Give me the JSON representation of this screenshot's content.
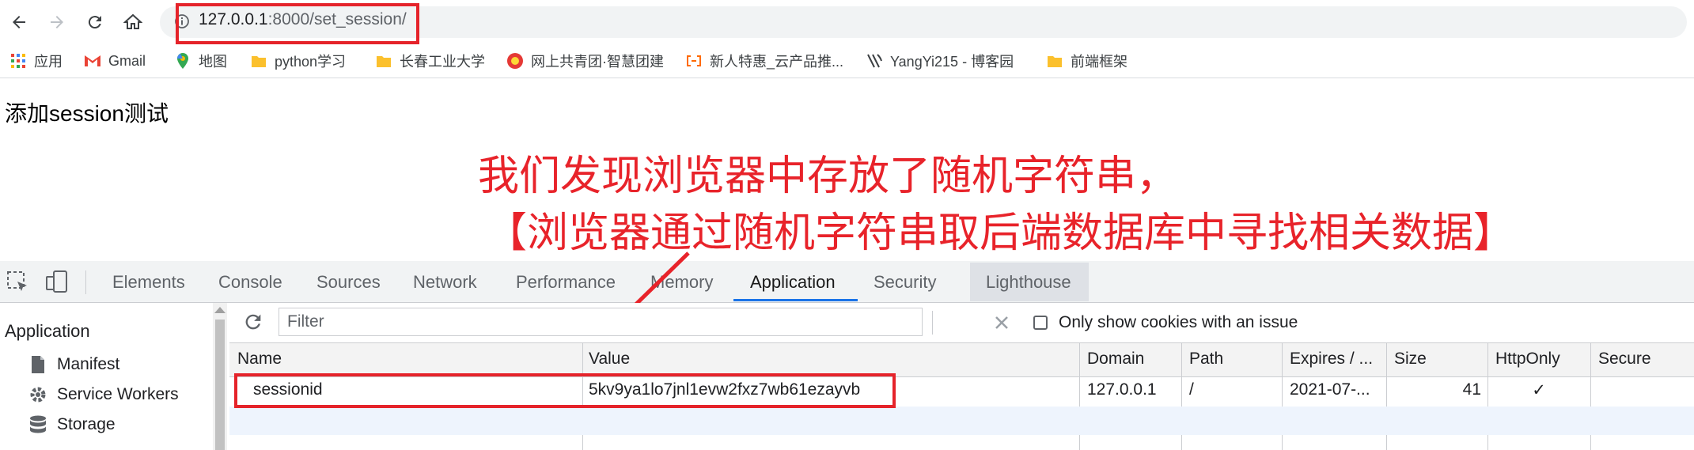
{
  "browser": {
    "url_host": "127.0.0.1",
    "url_rest": ":8000/set_session/",
    "bookmarks": [
      {
        "label": "应用"
      },
      {
        "label": "Gmail"
      },
      {
        "label": "地图"
      },
      {
        "label": "python学习"
      },
      {
        "label": "长春工业大学"
      },
      {
        "label": "网上共青团·智慧团建"
      },
      {
        "label": "新人特惠_云产品推..."
      },
      {
        "label": "YangYi215 - 博客园"
      },
      {
        "label": "前端框架"
      }
    ]
  },
  "page": {
    "heading": "添加session测试"
  },
  "annotation": {
    "line1": "我们发现浏览器中存放了随机字符串，",
    "line2": "【浏览器通过随机字符串取后端数据库中寻找相关数据】"
  },
  "devtools": {
    "tabs": [
      "Elements",
      "Console",
      "Sources",
      "Network",
      "Performance",
      "Memory",
      "Application",
      "Security",
      "Lighthouse"
    ],
    "active_tab": "Application",
    "sidebar": {
      "heading": "Application",
      "items": [
        {
          "label": "Manifest",
          "icon": "document-icon"
        },
        {
          "label": "Service Workers",
          "icon": "gear-icon"
        },
        {
          "label": "Storage",
          "icon": "database-icon"
        }
      ]
    },
    "filter_placeholder": "Filter",
    "only_issue_label": "Only show cookies with an issue",
    "columns": [
      "Name",
      "Value",
      "Domain",
      "Path",
      "Expires / ...",
      "Size",
      "HttpOnly",
      "Secure"
    ],
    "rows": [
      {
        "name": "sessionid",
        "value": "5kv9ya1lo7jnl1evw2fxz7wb61ezayvb",
        "domain": "127.0.0.1",
        "path": "/",
        "expires": "2021-07-...",
        "size": "41",
        "httponly": "✓",
        "secure": ""
      }
    ]
  },
  "colors": {
    "annotation_red": "#e8232a",
    "active_tab_blue": "#1a73e8"
  }
}
